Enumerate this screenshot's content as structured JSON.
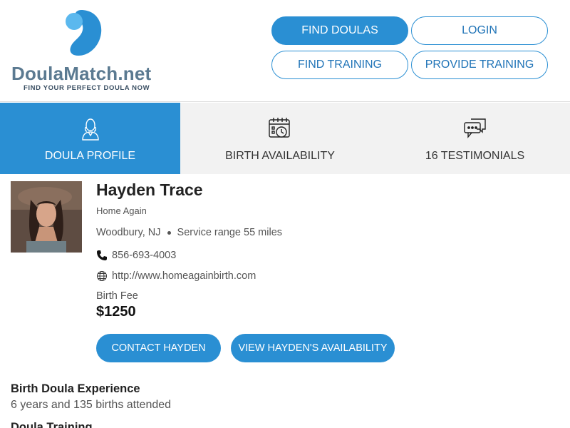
{
  "brand": {
    "name_part1": "DoulaMatch",
    "name_part2": ".net",
    "tagline": "FIND YOUR PERFECT DOULA NOW",
    "colors": {
      "primary": "#2a8fd3",
      "logo_dark": "#2a8fd3",
      "logo_light": "#5bb8ee",
      "logo_text": "#5b7a91"
    }
  },
  "nav": {
    "find_doulas": "FIND DOULAS",
    "login": "LOGIN",
    "find_training": "FIND TRAINING",
    "provide_training": "PROVIDE TRAINING"
  },
  "tabs": [
    {
      "label": "DOULA PROFILE",
      "icon": "doula-person-icon",
      "active": true
    },
    {
      "label": "BIRTH AVAILABILITY",
      "icon": "calendar-clock-icon",
      "active": false
    },
    {
      "label": "16 TESTIMONIALS",
      "icon": "chat-bubbles-icon",
      "active": false
    }
  ],
  "profile": {
    "name": "Hayden Trace",
    "business": "Home Again",
    "location": "Woodbury, NJ",
    "service_range": "Service range 55 miles",
    "phone": "856-693-4003",
    "website": "http://www.homeagainbirth.com",
    "fee_label": "Birth Fee",
    "fee_value": "$1250"
  },
  "actions": {
    "contact": "CONTACT HAYDEN",
    "availability": "VIEW HAYDEN'S AVAILABILITY"
  },
  "experience": {
    "title": "Birth Doula Experience",
    "text": "6 years and 135 births attended"
  },
  "training": {
    "title": "Doula Training"
  }
}
